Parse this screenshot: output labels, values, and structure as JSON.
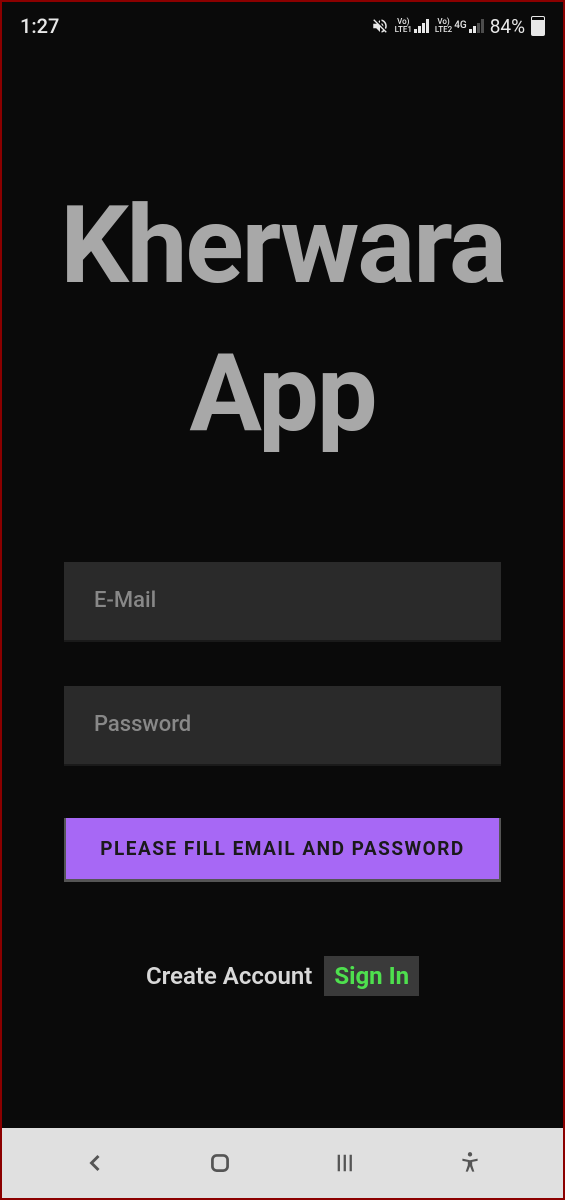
{
  "status_bar": {
    "time": "1:27",
    "lte1": "Vo)\nLTE1",
    "lte2": "Vo)\nLTE2",
    "network": "4G",
    "battery_percent": "84%"
  },
  "app": {
    "title_line1": "Kherwara",
    "title_line2": "App"
  },
  "form": {
    "email_placeholder": "E-Mail",
    "password_placeholder": "Password",
    "submit_label": "PLEASE FILL EMAIL AND PASSWORD",
    "create_account_label": "Create Account",
    "sign_in_label": "Sign In"
  }
}
